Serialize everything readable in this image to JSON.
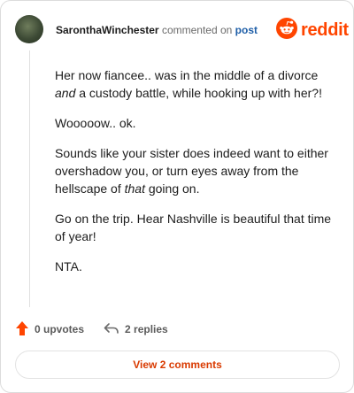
{
  "header": {
    "username": "SaronthaWinchester",
    "action_text": "commented on",
    "post_link": "post",
    "brand": "reddit"
  },
  "comment": {
    "p1_before": "Her now fiancee.. was in the middle of a divorce ",
    "p1_em": "and",
    "p1_after": " a custody battle, while hooking up with her?!",
    "p2": "Wooooow.. ok.",
    "p3_before": "Sounds like your sister does indeed want to either overshadow you, or turn eyes away from the hellscape of ",
    "p3_em": "that",
    "p3_after": " going on.",
    "p4": "Go on the trip. Hear Nashville is beautiful that time of year!",
    "p5": "NTA."
  },
  "actions": {
    "upvotes_label": "0 upvotes",
    "replies_label": "2 replies"
  },
  "footer": {
    "view_comments_label": "View 2 comments"
  },
  "colors": {
    "brand": "#ff4500",
    "upvote": "#ff4500",
    "link": "#1f5fa8",
    "button_text": "#d93a00"
  },
  "icons": {
    "avatar": "user-avatar",
    "logo": "reddit-snoo-icon",
    "upvote": "upvote-arrow-icon",
    "reply": "reply-arrow-icon"
  }
}
